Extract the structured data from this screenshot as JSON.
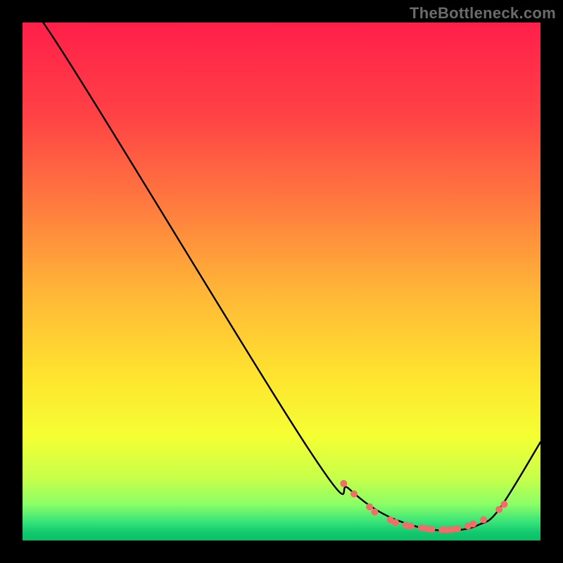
{
  "watermark": "TheBottleneck.com",
  "chart_data": {
    "type": "line",
    "title": "",
    "xlabel": "",
    "ylabel": "",
    "xlim": [
      0,
      100
    ],
    "ylim": [
      0,
      100
    ],
    "series": [
      {
        "name": "curve",
        "x": [
          0,
          6,
          55,
          63,
          69,
          75,
          80,
          84,
          88,
          92,
          100
        ],
        "y": [
          102,
          97,
          18,
          10,
          5.5,
          3,
          2,
          2,
          3,
          6,
          19
        ],
        "stroke": "#000000",
        "fill": false
      }
    ],
    "markers": {
      "name": "dots",
      "color": "#ef6e6a",
      "radius": 5,
      "points": [
        {
          "x": 62,
          "y": 11
        },
        {
          "x": 64,
          "y": 9
        },
        {
          "x": 67,
          "y": 6.5
        },
        {
          "x": 68,
          "y": 5.5
        },
        {
          "x": 71,
          "y": 4
        },
        {
          "x": 72,
          "y": 3.5
        },
        {
          "x": 74,
          "y": 3
        },
        {
          "x": 75,
          "y": 2.8
        },
        {
          "x": 77,
          "y": 2.5
        },
        {
          "x": 78,
          "y": 2.3
        },
        {
          "x": 79,
          "y": 2.2
        },
        {
          "x": 81,
          "y": 2.1
        },
        {
          "x": 82,
          "y": 2.1
        },
        {
          "x": 83,
          "y": 2.2
        },
        {
          "x": 84,
          "y": 2.3
        },
        {
          "x": 86,
          "y": 2.8
        },
        {
          "x": 87,
          "y": 3.2
        },
        {
          "x": 89,
          "y": 4
        },
        {
          "x": 92,
          "y": 6
        },
        {
          "x": 93,
          "y": 7
        }
      ]
    },
    "gradient_stops": [
      {
        "t": 0.0,
        "c": "#ff1f4a"
      },
      {
        "t": 0.18,
        "c": "#ff4245"
      },
      {
        "t": 0.35,
        "c": "#ff7a3f"
      },
      {
        "t": 0.52,
        "c": "#ffb637"
      },
      {
        "t": 0.68,
        "c": "#ffe32f"
      },
      {
        "t": 0.8,
        "c": "#f4ff33"
      },
      {
        "t": 0.88,
        "c": "#c6ff4a"
      },
      {
        "t": 0.93,
        "c": "#8aff66"
      },
      {
        "t": 0.965,
        "c": "#34e37a"
      },
      {
        "t": 0.985,
        "c": "#12c86e"
      },
      {
        "t": 1.0,
        "c": "#0bbf67"
      }
    ]
  }
}
